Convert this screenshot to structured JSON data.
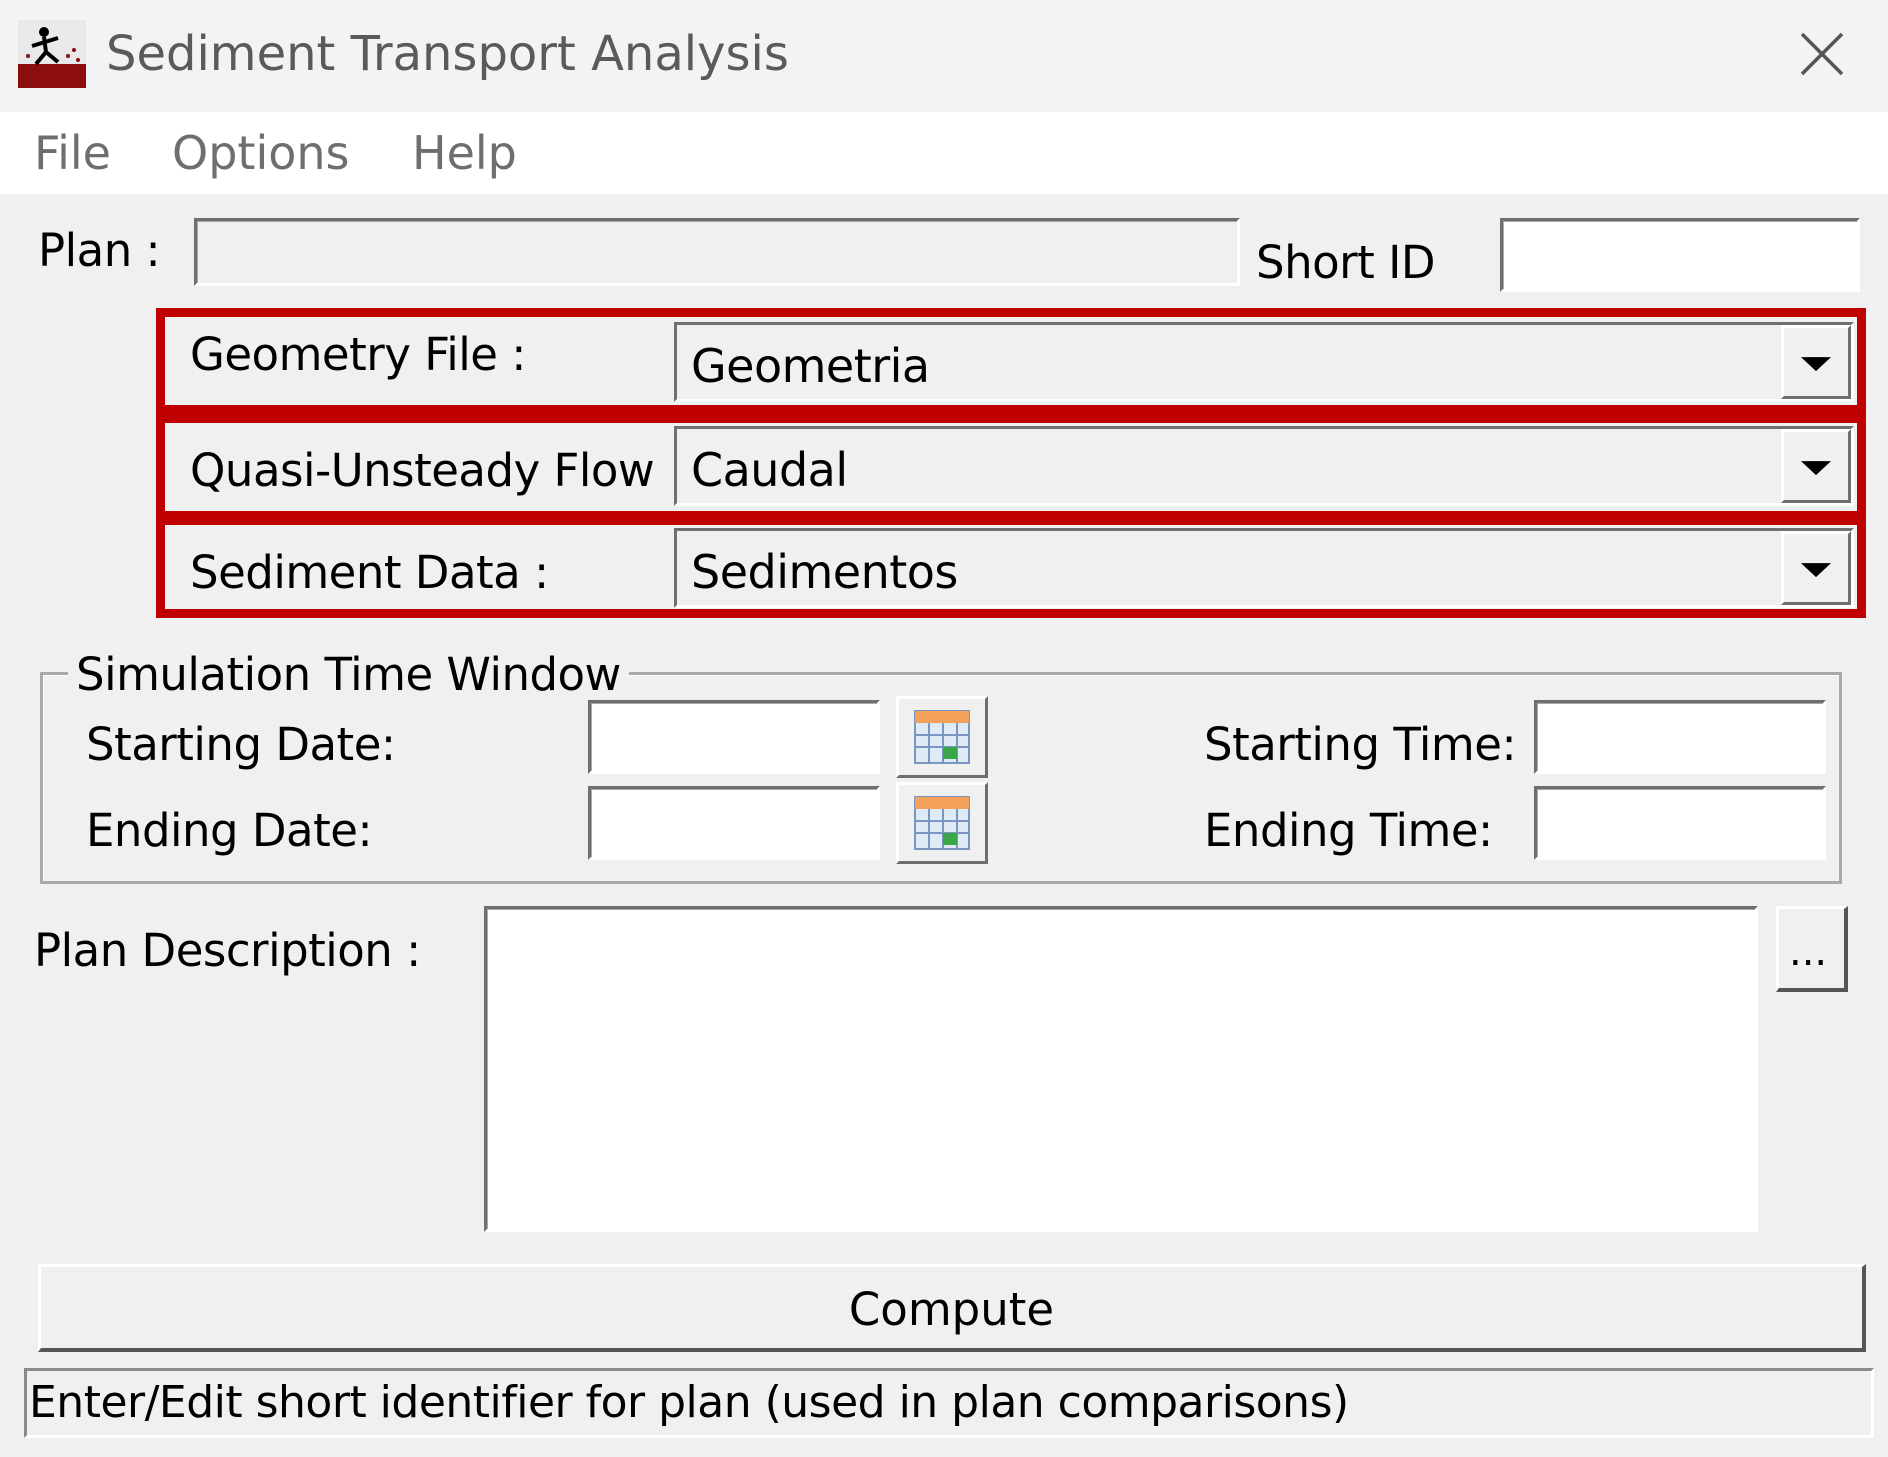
{
  "window": {
    "title": "Sediment Transport Analysis",
    "app_icon": "sediment-app-icon",
    "close_icon": "close-icon"
  },
  "menu": [
    "File",
    "Options",
    "Help"
  ],
  "plan": {
    "label": "Plan :",
    "value": ""
  },
  "short_id": {
    "label": "Short ID",
    "value": ""
  },
  "geometry": {
    "label": "Geometry File :",
    "value": "Geometria"
  },
  "flow": {
    "label": "Quasi-Unsteady Flow",
    "value": "Caudal"
  },
  "sediment": {
    "label": "Sediment Data :",
    "value": "Sedimentos"
  },
  "time_window": {
    "title": "Simulation Time Window",
    "starting_date_label": "Starting Date:",
    "ending_date_label": "Ending Date:",
    "starting_time_label": "Starting Time:",
    "ending_time_label": "Ending Time:",
    "starting_date": "",
    "ending_date": "",
    "starting_time": "",
    "ending_time": ""
  },
  "description": {
    "label": "Plan Description :",
    "value": "",
    "more_label": "..."
  },
  "compute_label": "Compute",
  "status_text": "Enter/Edit short identifier for plan (used in plan comparisons)",
  "colors": {
    "highlight": "#c00000",
    "window_bg": "#f0f0f0"
  }
}
